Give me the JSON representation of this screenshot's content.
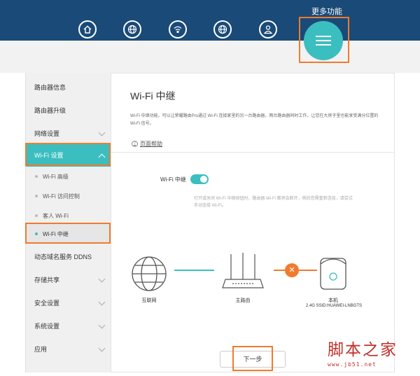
{
  "topbar": {
    "nav_icons": [
      "home-icon",
      "globe-icon",
      "wifi-icon",
      "globe-settings-icon",
      "user-icon"
    ],
    "more_label": "更多功能",
    "more_icon": "menu-icon",
    "bg_color": "#1a4a78",
    "accent": "#3bbec0"
  },
  "sidebar": {
    "items": [
      {
        "label": "路由器信息"
      },
      {
        "label": "路由器升级"
      },
      {
        "label": "网络设置"
      },
      {
        "label": "Wi-Fi 设置"
      }
    ],
    "sub_items": [
      {
        "label": "Wi-Fi 高级"
      },
      {
        "label": "Wi-Fi 访问控制"
      },
      {
        "label": "客人 Wi-Fi"
      },
      {
        "label": "Wi-Fi 中继"
      }
    ],
    "items_after": [
      {
        "label": "动态域名服务 DDNS"
      },
      {
        "label": "存储共享"
      },
      {
        "label": "安全设置"
      },
      {
        "label": "系统设置"
      },
      {
        "label": "应用"
      }
    ]
  },
  "main": {
    "title": "Wi-Fi 中继",
    "description": "Wi-Fi 中继功能，可以让荣耀路由Pro通过 Wi-Fi 连接家里的另一台路由器，两台路由器同时工作，让您在大房子里也能享受满分位置的 Wi-Fi 信号。",
    "help_label": "页面帮助",
    "switch_label": "Wi-Fi 中继",
    "switch_on": true,
    "note": "打开或关闭 Wi-Fi 中继按钮时，路由器 Wi-Fi 都将会断开，稍后您需重新连接，请尝试手动连接 Wi-Fi。",
    "internet_label": "互联网",
    "router_label": "主路由",
    "local_label": "本机",
    "local_ssid": "2.4G SSID:HUAWEI-LNBGTS",
    "next_label": "下一步"
  },
  "watermark": {
    "title": "脚本之家",
    "url": "www.jb51.net"
  }
}
